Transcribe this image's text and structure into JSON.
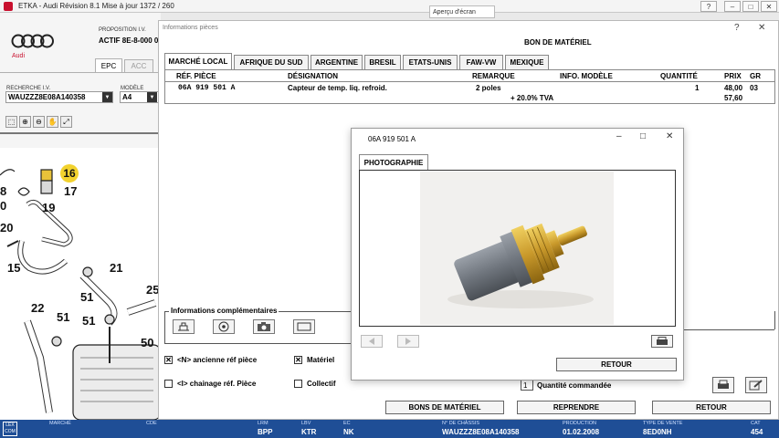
{
  "window": {
    "title": "ETKA - Audi Révision 8.1 Mise à jour 1372 / 260",
    "tooltip": "Aperçu d'écran"
  },
  "left": {
    "brand": "Audi",
    "proposition_label": "PROPOSITION I.V.",
    "actif": "ACTIF  8E-8-000 0",
    "tabs": [
      "EPC",
      "ACC"
    ],
    "recherche_label": "RECHERCHE I.V.",
    "recherche_value": "WAUZZZ8E08A140358",
    "modele_label": "MODÈLE",
    "modele_value": "A4",
    "callouts": [
      "16",
      "17",
      "8",
      "0",
      "19",
      "20",
      "15",
      "21",
      "51",
      "22",
      "51",
      "51",
      "25",
      "50"
    ]
  },
  "main": {
    "title": "Informations pièces",
    "header": "BON DE MATÉRIEL",
    "help": "?",
    "close": "✕",
    "tabs": [
      "MARCHÉ LOCAL",
      "AFRIQUE DU SUD",
      "ARGENTINE",
      "BRESIL",
      "ETATS-UNIS",
      "FAW-VW",
      "MEXIQUE"
    ],
    "columns": {
      "ref": "RÉF. PIÈCE",
      "designation": "DÉSIGNATION",
      "remarque": "REMARQUE",
      "info": "INFO. MODÈLE",
      "quantite": "QUANTITÉ",
      "prix": "PRIX",
      "gr": "GR"
    },
    "row": {
      "ref": "06A  919  501  A",
      "designation": "Capteur de temp. liq. refroid.",
      "remarque": "2 poles",
      "quantite": "1",
      "prix": "48,00",
      "gr": "03"
    },
    "tva_label": "+ 20.0% TVA",
    "tva_total": "57,60",
    "info_comp_label": "Informations complémentaires",
    "chk_ancienne": "<N> ancienne réf pièce",
    "chk_ancienne_checked": "✕",
    "chk_materiel": "Matériel",
    "chk_materiel_checked": "✕",
    "chk_chainage": "<I> chainage réf. Pièce",
    "chk_collectif": "Collectif",
    "qty_value": "1",
    "qty_label": "Quantité commandée",
    "btn_bons": "BONS DE MATÉRIEL",
    "btn_reprendre": "REPRENDRE",
    "btn_retour": "RETOUR"
  },
  "photo": {
    "title": "06A 919 501 A",
    "tab": "PHOTOGRAPHIE",
    "retour": "RETOUR"
  },
  "status": {
    "items": [
      {
        "label": "MARCHÉ",
        "value": ""
      },
      {
        "label": "CDE",
        "value": ""
      },
      {
        "label": "LRM",
        "value": "BPP"
      },
      {
        "label": "LBV",
        "value": "KTR"
      },
      {
        "label": "EC",
        "value": "NK"
      },
      {
        "label": "N° DE CHÂSSIS",
        "value": "WAUZZZ8E08A140358"
      },
      {
        "label": "PRODUCTION",
        "value": "01.02.2008"
      },
      {
        "label": "TYPE DE VENTE",
        "value": "8ED0NH"
      },
      {
        "label": "CAT",
        "value": "454"
      }
    ],
    "logo": "LEX COM"
  },
  "colors": {
    "accent": "#1f4e96",
    "audi_red": "#c8102e",
    "highlight": "#f2d22e"
  }
}
